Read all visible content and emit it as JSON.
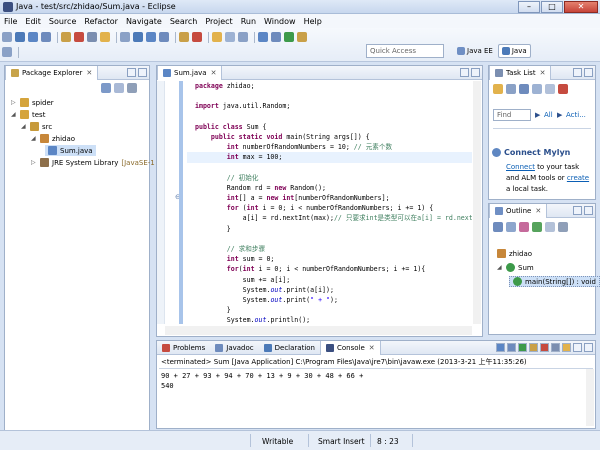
{
  "window": {
    "title": "Java - test/src/zhidao/Sum.java - Eclipse"
  },
  "menu": [
    "File",
    "Edit",
    "Source",
    "Refactor",
    "Navigate",
    "Search",
    "Project",
    "Run",
    "Window",
    "Help"
  ],
  "toolbar": {
    "quick_access_placeholder": "Quick Access",
    "perspectives": [
      {
        "label": "Java EE",
        "active": false
      },
      {
        "label": "Java",
        "active": true
      }
    ]
  },
  "package_explorer": {
    "tab_label": "Package Explorer",
    "tree": [
      {
        "label": "spider",
        "icon": "project-folder-icon",
        "expanded": false
      },
      {
        "label": "test",
        "icon": "project-folder-icon",
        "expanded": true
      },
      {
        "label": "src",
        "icon": "source-folder-icon",
        "expanded": true
      },
      {
        "label": "zhidao",
        "icon": "package-icon",
        "expanded": true
      },
      {
        "label": "Sum.java",
        "icon": "java-file-icon",
        "expanded": false,
        "selected": true
      },
      {
        "label": "JRE System Library",
        "suffix": "[JavaSE-1",
        "icon": "library-icon",
        "expanded": false
      }
    ]
  },
  "editor": {
    "tab_label": "Sum.java",
    "lines": [
      [
        {
          "t": "package ",
          "c": "kw"
        },
        {
          "t": "zhidao;"
        }
      ],
      [
        {
          "t": ""
        }
      ],
      [
        {
          "t": "import ",
          "c": "kw"
        },
        {
          "t": "java.util.Random;"
        }
      ],
      [
        {
          "t": ""
        }
      ],
      [
        {
          "t": "public class ",
          "c": "kw"
        },
        {
          "t": "Sum {"
        }
      ],
      [
        {
          "t": "    public static void ",
          "c": "kw"
        },
        {
          "t": "main(String args[]) {"
        }
      ],
      [
        {
          "t": "        int ",
          "c": "kw"
        },
        {
          "t": "numberOfRandomNumbers = 10; "
        },
        {
          "t": "// 元素个数",
          "c": "cm"
        }
      ],
      [
        {
          "t": "        int ",
          "c": "kw"
        },
        {
          "t": "max = 100;"
        }
      ],
      [
        {
          "t": ""
        }
      ],
      [
        {
          "t": "        // 初始化",
          "c": "cm"
        }
      ],
      [
        {
          "t": "        Random rd = "
        },
        {
          "t": "new ",
          "c": "kw"
        },
        {
          "t": "Random();"
        }
      ],
      [
        {
          "t": "        int",
          "c": "kw"
        },
        {
          "t": "[] a = "
        },
        {
          "t": "new int",
          "c": "kw"
        },
        {
          "t": "[numberOfRandomNumbers];"
        }
      ],
      [
        {
          "t": "        for ",
          "c": "kw"
        },
        {
          "t": "("
        },
        {
          "t": "int ",
          "c": "kw"
        },
        {
          "t": "i = 0; i < numberOfRandomNumbers; i += 1) {"
        }
      ],
      [
        {
          "t": "            a[i] = rd.nextInt(max);"
        },
        {
          "t": "// 只要求int是类型可以在a[i] = rd.nextInt",
          "c": "cm"
        }
      ],
      [
        {
          "t": "        }"
        }
      ],
      [
        {
          "t": ""
        }
      ],
      [
        {
          "t": "        // 求和步骤",
          "c": "cm"
        }
      ],
      [
        {
          "t": "        int ",
          "c": "kw"
        },
        {
          "t": "sum = 0;"
        }
      ],
      [
        {
          "t": "        for",
          "c": "kw"
        },
        {
          "t": "("
        },
        {
          "t": "int ",
          "c": "kw"
        },
        {
          "t": "i = 0; i < numberOfRandomNumbers; i += 1){"
        }
      ],
      [
        {
          "t": "            sum += a[i];"
        }
      ],
      [
        {
          "t": "            System."
        },
        {
          "t": "out",
          "c": "it"
        },
        {
          "t": ".print(a[i]);"
        }
      ],
      [
        {
          "t": "            System."
        },
        {
          "t": "out",
          "c": "it"
        },
        {
          "t": ".print("
        },
        {
          "t": "\" + \"",
          "c": "st"
        },
        {
          "t": ");"
        }
      ],
      [
        {
          "t": "        }"
        }
      ],
      [
        {
          "t": "        System."
        },
        {
          "t": "out",
          "c": "it"
        },
        {
          "t": ".println();"
        }
      ],
      [
        {
          "t": "        System."
        },
        {
          "t": "out",
          "c": "it"
        },
        {
          "t": ".println(sum);"
        }
      ],
      [
        {
          "t": "    }"
        }
      ],
      [
        {
          "t": "}"
        }
      ]
    ]
  },
  "task_list": {
    "tab_label": "Task List",
    "find_placeholder": "Find",
    "filter_all": "All",
    "filter_activate": "Acti...",
    "mylyn_title": "Connect Mylyn",
    "mylyn_text_connect": "Connect",
    "mylyn_text_mid": " to your task and ALM tools or ",
    "mylyn_text_create": "create",
    "mylyn_text_end": " a local task."
  },
  "outline": {
    "tab_label": "Outline",
    "items": [
      {
        "label": "zhidao",
        "icon": "package-icon"
      },
      {
        "label": "Sum",
        "icon": "class-icon"
      },
      {
        "label": "main(String[]) : void",
        "icon": "method-icon"
      }
    ]
  },
  "console": {
    "tabs": [
      "Problems",
      "Javadoc",
      "Declaration",
      "Console"
    ],
    "active_tab": "Console",
    "header": "<terminated> Sum [Java Application] C:\\Program Files\\Java\\jre7\\bin\\javaw.exe (2013-3-21 上午11:35:26)",
    "output": [
      "90 + 27 + 93 + 94 + 70 + 13 + 9 + 30 + 48 + 66 +",
      "540"
    ]
  },
  "statusbar": {
    "mode": "Writable",
    "insert": "Smart Insert",
    "position": "8 : 23"
  },
  "colors": {
    "keyword": "#7f0055",
    "comment": "#3f7f5f",
    "string": "#2a00ff",
    "field": "#0000c0",
    "link": "#0b5fb5"
  }
}
